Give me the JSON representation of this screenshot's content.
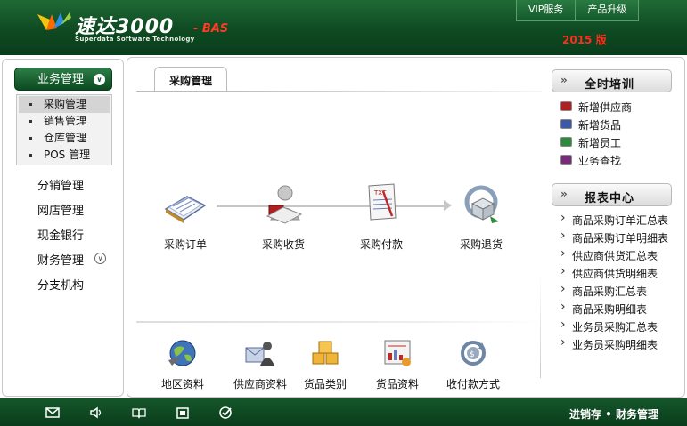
{
  "header": {
    "logo_text": "速达3000",
    "logo_suffix": "- BAS",
    "logo_sub": "Superdata Software Technology",
    "vip_label": "VIP服务",
    "upgrade_label": "产品升级",
    "version": "2015 版"
  },
  "sidebar": {
    "module": "业务管理",
    "submenu": [
      "采购管理",
      "销售管理",
      "仓库管理",
      "POS 管理"
    ],
    "items": [
      "分销管理",
      "网店管理",
      "现金银行",
      "财务管理",
      "分支机构"
    ]
  },
  "main": {
    "tab": "采购管理",
    "flow": [
      "采购订单",
      "采购收货",
      "采购付款",
      "采购退货"
    ],
    "basics": [
      "地区资料",
      "供应商资料",
      "货品类别",
      "货品资料",
      "收付款方式"
    ]
  },
  "training": {
    "title": "全时培训",
    "arrow": "»",
    "items": [
      "新增供应商",
      "新增货品",
      "新增员工",
      "业务查找"
    ]
  },
  "reports": {
    "title": "报表中心",
    "arrow": "»",
    "items": [
      "商品采购订单汇总表",
      "商品采购订单明细表",
      "供应商供货汇总表",
      "供应商供货明细表",
      "商品采购汇总表",
      "商品采购明细表",
      "业务员采购汇总表",
      "业务员采购明细表"
    ]
  },
  "footer": {
    "text": "进销存 • 财务管理",
    "icons": [
      "mail-icon",
      "speaker-icon",
      "book-icon",
      "calendar-icon",
      "check-icon"
    ]
  },
  "colors": {
    "brand_green": "#0e4a22",
    "version_red": "#ff2d1e"
  }
}
